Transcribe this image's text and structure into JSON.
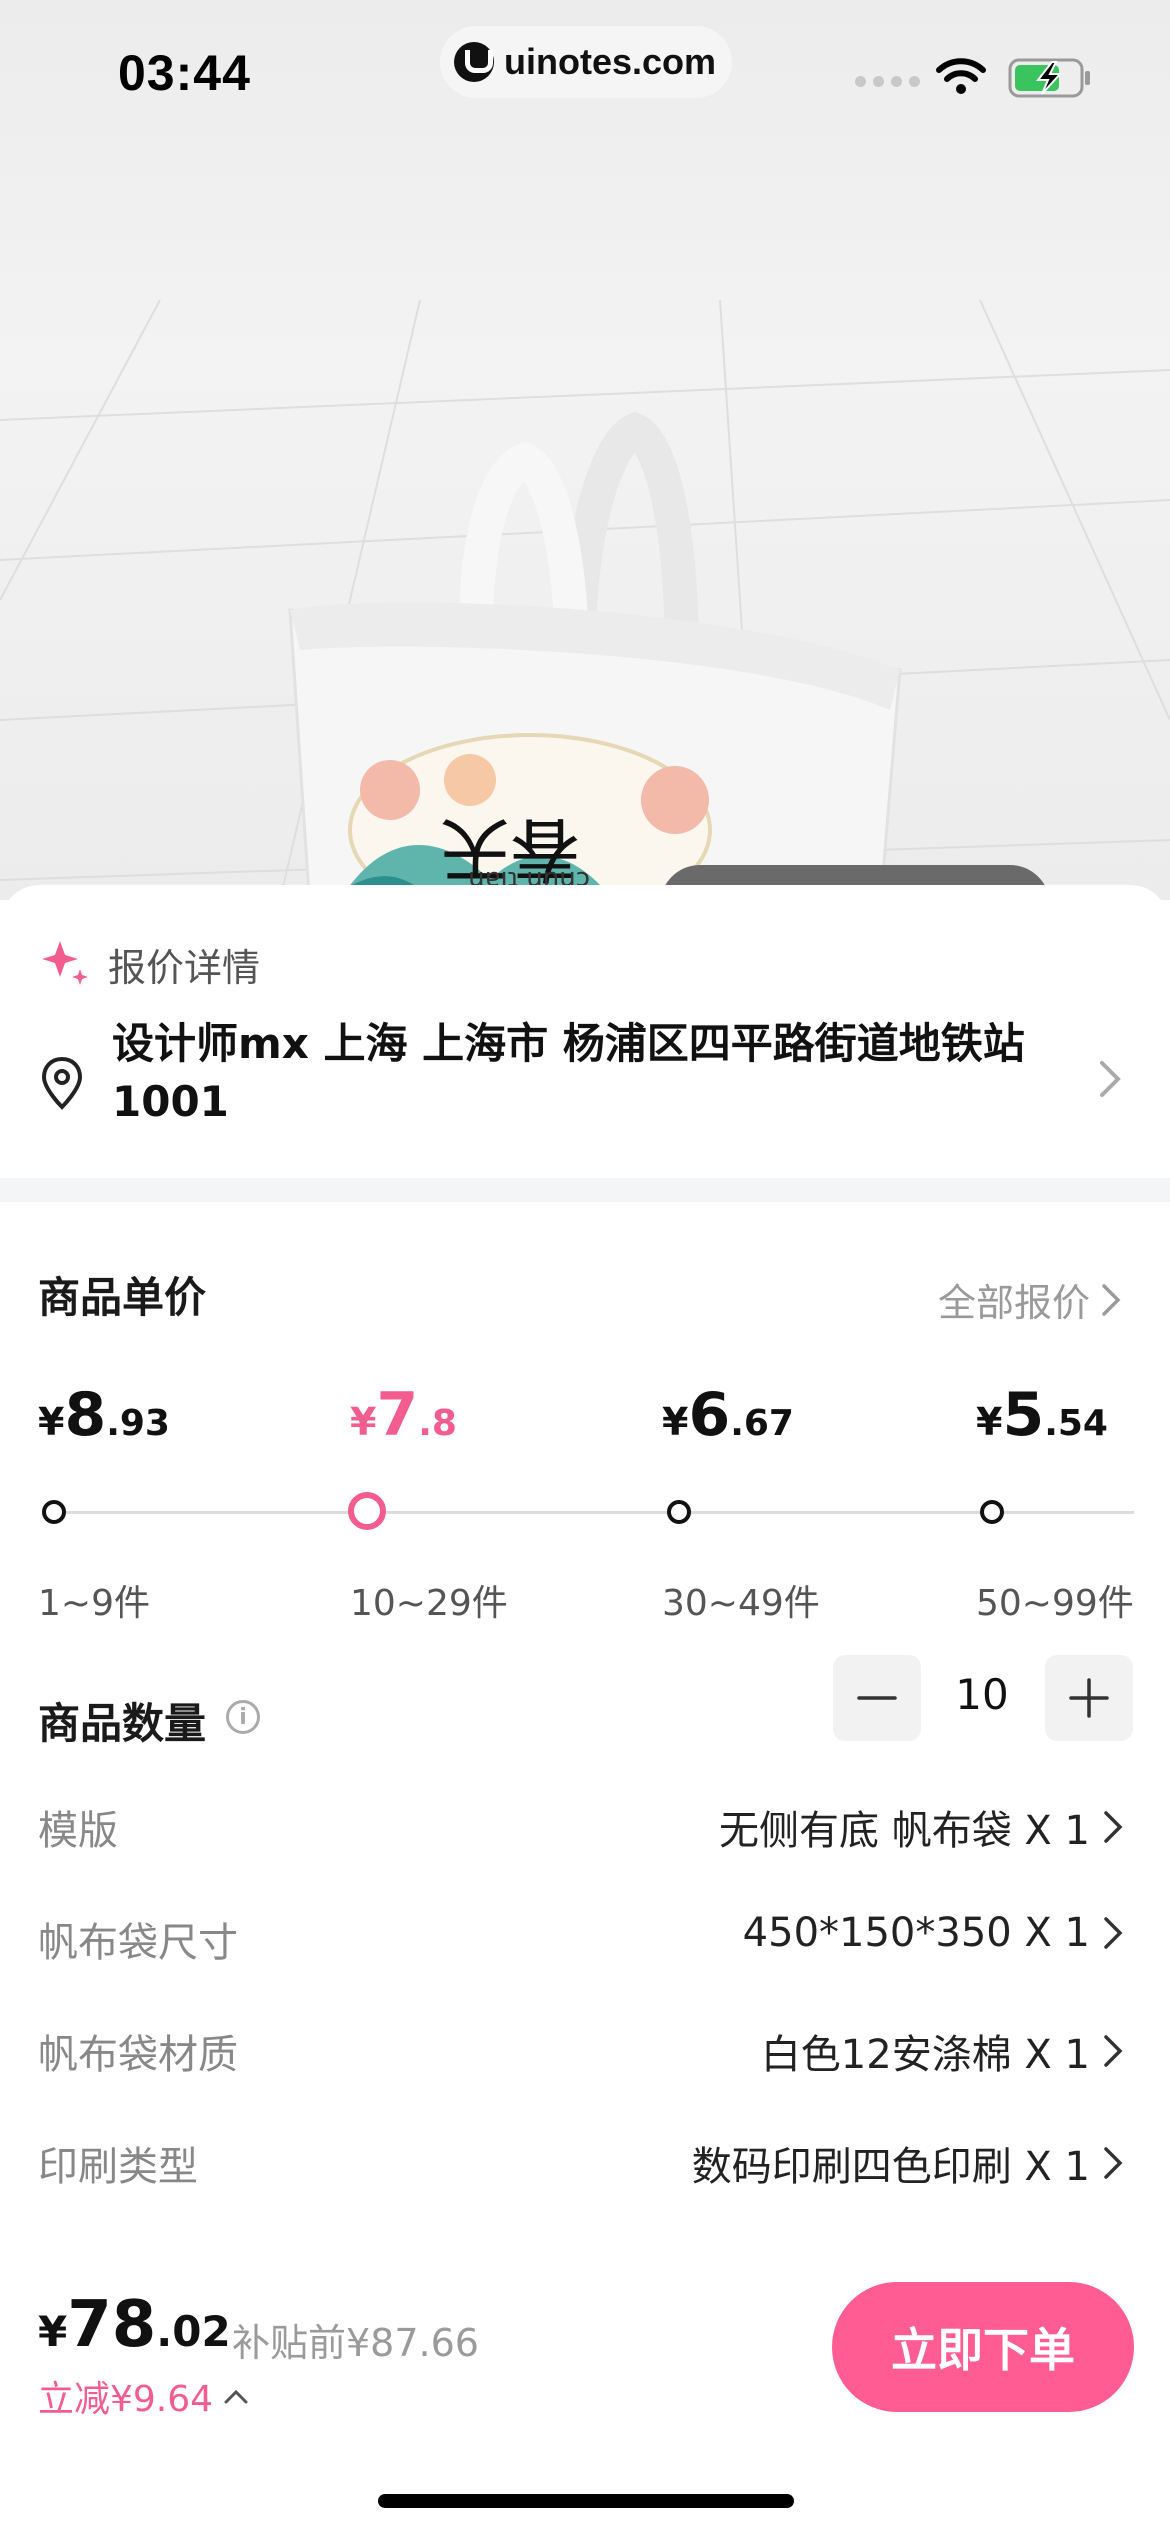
{
  "status_bar": {
    "time": "03:44",
    "url": "uinotes.com"
  },
  "quote": {
    "title": "报价详情",
    "address": "设计师mx 上海 上海市 杨浦区四平路街道地铁站1001"
  },
  "unit_price": {
    "title": "商品单价",
    "all_quotes": "全部报价",
    "tiers": [
      {
        "yen": "¥",
        "int": "8",
        "dec": ".93",
        "range": "1~9件",
        "active": false
      },
      {
        "yen": "¥",
        "int": "7",
        "dec": ".8",
        "range": "10~29件",
        "active": true
      },
      {
        "yen": "¥",
        "int": "6",
        "dec": ".67",
        "range": "30~49件",
        "active": false
      },
      {
        "yen": "¥",
        "int": "5",
        "dec": ".54",
        "range": "50~99件",
        "active": false
      }
    ]
  },
  "quantity": {
    "title": "商品数量",
    "info_glyph": "i",
    "value": "10"
  },
  "options": [
    {
      "label": "模版",
      "value": "无侧有底 帆布袋 X 1"
    },
    {
      "label": "帆布袋尺寸",
      "value": "450*150*350 X 1"
    },
    {
      "label": "帆布袋材质",
      "value": "白色12安涤棉 X 1"
    },
    {
      "label": "印刷类型",
      "value": "数码印刷四色印刷 X 1"
    }
  ],
  "bottom_bar": {
    "total_yen": "¥",
    "total_int": "78",
    "total_dec": ".02",
    "original_price": "补贴前¥87.66",
    "discount": "立减¥9.64",
    "order_label": "立即下单"
  },
  "product_image": {
    "print_text": "春天",
    "print_pinyin": "chūn tiān"
  },
  "colors": {
    "accent_pink": "#f25c8f",
    "button_pink": "#ff5c94",
    "muted_text": "#9a9a9a"
  }
}
